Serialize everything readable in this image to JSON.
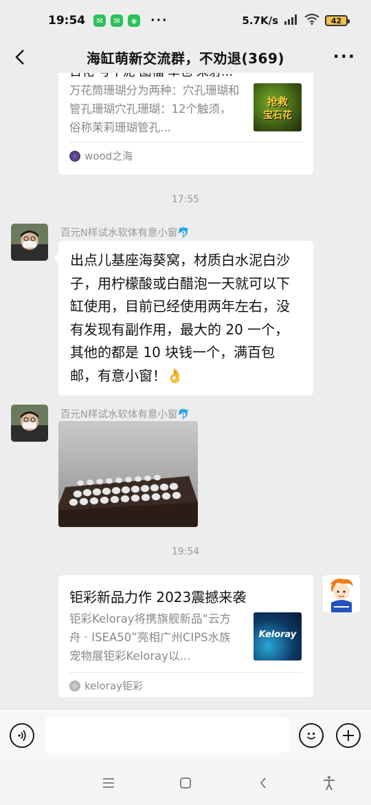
{
  "status_bar": {
    "time": "19:54",
    "app_badges": [
      "wechat-icon",
      "wechat-icon",
      "shield-app-icon"
    ],
    "more": "···",
    "net_speed": "5.7K/s",
    "battery": "42"
  },
  "nav": {
    "title": "海缸萌新交流群，不劝退(369)",
    "more": "···"
  },
  "messages": {
    "card1": {
      "title_partial": "百花 号不泥 图福 草也 采射...",
      "desc": "万花筒珊瑚分为两种：穴孔珊瑚和管孔珊瑚穴孔珊瑚：12个触须，俗称茉莉珊瑚管孔...",
      "thumb_text_1": "抢救",
      "thumb_text_2": "宝石花",
      "source": "wood之海"
    },
    "time1": "17:55",
    "msg1": {
      "sender": "百元N样试水软体有意小窗🐬",
      "text": "出点儿基座海葵窝，材质白水泥白沙子，用柠檬酸或白醋泡一天就可以下缸使用，目前已经使用两年左右，没有发现有副作用，最大的 20 一个，其他的都是 10 块钱一个，满百包邮，有意小窗！👌"
    },
    "msg2": {
      "sender": "百元N样试水软体有意小窗🐬"
    },
    "time2": "19:54",
    "card2": {
      "title": "钜彩新品力作 2023震撼来袭",
      "desc": "钜彩Keloray将携旗舰新品“云方舟 · ISEA50”亮相广州CIPS水族宠物展钜彩Keloray以...",
      "thumb_text": "Keloray",
      "source": "keloray钜彩"
    }
  },
  "colors": {
    "background": "#ededed",
    "bubble": "#ffffff",
    "secondary_text": "#888888",
    "wechat_green": "#2bc15a"
  }
}
